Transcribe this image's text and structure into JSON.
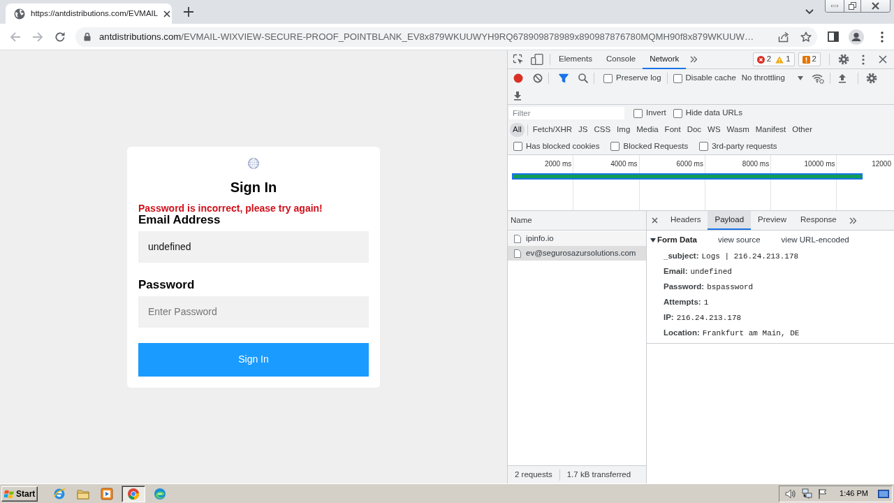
{
  "browser": {
    "tabs": [
      {
        "title": "https://antdistributions.com/EVMAIL",
        "selected": true
      }
    ],
    "url": {
      "host": "antdistributions.com",
      "path": "/EVMAIL-WIXVIEW-SECURE-PROOF_POINTBLANK_EV8x879WKUUWYH9RQ678909878989x890987876780MQMH90f8x879WKUUW…"
    }
  },
  "page": {
    "title": "Sign In",
    "error": "Password is incorrect, please try again!",
    "fields": [
      {
        "label": "Email Address",
        "value": "undefined"
      },
      {
        "label": "Password",
        "placeholder": "Enter Password"
      }
    ],
    "submit": "Sign In"
  },
  "devtools": {
    "tabs": [
      {
        "label": "Elements",
        "selected": false
      },
      {
        "label": "Console",
        "selected": false
      },
      {
        "label": "Network",
        "selected": true
      }
    ],
    "console_counts": {
      "errors": "2",
      "warnings": "1"
    },
    "issues": "2",
    "recording": true,
    "filter_on": true,
    "options": [
      {
        "label": "Preserve log",
        "checked": false
      },
      {
        "label": "Disable cache",
        "checked": false
      }
    ],
    "throttling": "No throttling",
    "filter": {
      "placeholder": "Filter"
    },
    "filter_options": [
      {
        "label": "Invert",
        "checked": false
      },
      {
        "label": "Hide data URLs",
        "checked": false
      }
    ],
    "types": [
      {
        "label": "All",
        "selected": true
      },
      {
        "label": "Fetch/XHR",
        "selected": false
      },
      {
        "label": "JS",
        "selected": false
      },
      {
        "label": "CSS",
        "selected": false
      },
      {
        "label": "Img",
        "selected": false
      },
      {
        "label": "Media",
        "selected": false
      },
      {
        "label": "Font",
        "selected": false
      },
      {
        "label": "Doc",
        "selected": false
      },
      {
        "label": "WS",
        "selected": false
      },
      {
        "label": "Wasm",
        "selected": false
      },
      {
        "label": "Manifest",
        "selected": false
      },
      {
        "label": "Other",
        "selected": false
      }
    ],
    "blocked_options": [
      {
        "label": "Has blocked cookies",
        "checked": false
      },
      {
        "label": "Blocked Requests",
        "checked": false
      },
      {
        "label": "3rd-party requests",
        "checked": false
      }
    ],
    "timeline": {
      "ticks": [
        "2000 ms",
        "4000 ms",
        "6000 ms",
        "8000 ms",
        "10000 ms",
        "12000"
      ]
    },
    "requests": {
      "column": "Name",
      "rows": [
        {
          "name": "ipinfo.io",
          "selected": false
        },
        {
          "name": "ev@segurosazursolutions.com",
          "selected": true
        }
      ]
    },
    "summary": [
      "2 requests",
      "1.7 kB transferred"
    ],
    "detail": {
      "tabs": [
        {
          "label": "Headers",
          "selected": false
        },
        {
          "label": "Payload",
          "selected": true
        },
        {
          "label": "Preview",
          "selected": false
        },
        {
          "label": "Response",
          "selected": false
        }
      ],
      "section": {
        "title": "Form Data",
        "expanded": true,
        "links": [
          "view source",
          "view URL-encoded"
        ],
        "rows": [
          {
            "key": "_subject:",
            "value": "Logs | 216.24.213.178"
          },
          {
            "key": "Email:",
            "value": "undefined"
          },
          {
            "key": "Password:",
            "value": "bspassword"
          },
          {
            "key": "Attempts:",
            "value": "1"
          },
          {
            "key": "IP:",
            "value": "216.24.213.178"
          },
          {
            "key": "Location:",
            "value": "Frankfurt am Main, DE"
          }
        ]
      }
    }
  },
  "taskbar": {
    "start": "Start",
    "apps": [
      {
        "kind": "ie",
        "selected": false
      },
      {
        "kind": "explorer",
        "selected": false
      },
      {
        "kind": "media",
        "selected": false
      },
      {
        "kind": "chrome",
        "selected": true
      },
      {
        "kind": "edge",
        "selected": false
      }
    ],
    "clock": "1:46 PM"
  }
}
